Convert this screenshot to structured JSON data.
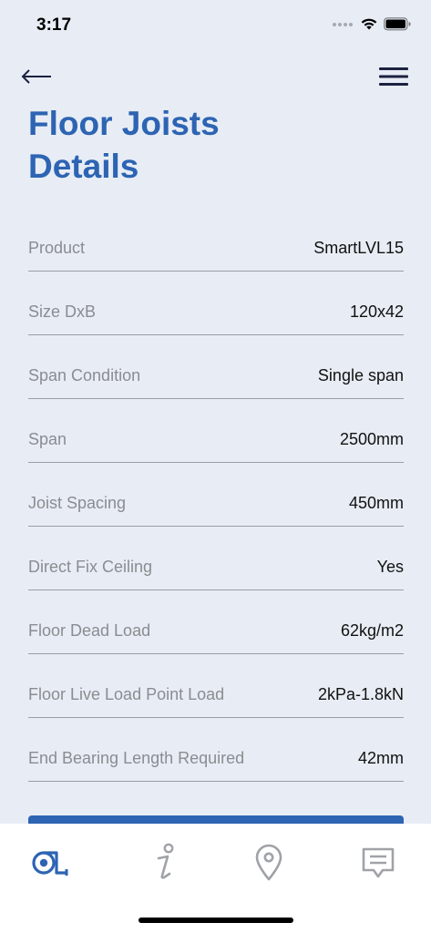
{
  "status": {
    "time": "3:17"
  },
  "page": {
    "title_line1": "Floor Joists",
    "title_line2": "Details"
  },
  "details": [
    {
      "label": "Product",
      "value": "SmartLVL15"
    },
    {
      "label": "Size DxB",
      "value": "120x42"
    },
    {
      "label": "Span Condition",
      "value": "Single span"
    },
    {
      "label": "Span",
      "value": "2500mm"
    },
    {
      "label": "Joist Spacing",
      "value": "450mm"
    },
    {
      "label": "Direct Fix Ceiling",
      "value": "Yes"
    },
    {
      "label": "Floor Dead Load",
      "value": "62kg/m2"
    },
    {
      "label": "Floor Live Load Point Load",
      "value": "2kPa-1.8kN"
    },
    {
      "label": "End Bearing Length Required",
      "value": "42mm"
    }
  ],
  "tabs": [
    {
      "icon": "tape-measure-icon",
      "active": true
    },
    {
      "icon": "info-icon",
      "active": false
    },
    {
      "icon": "location-pin-icon",
      "active": false
    },
    {
      "icon": "message-icon",
      "active": false
    }
  ],
  "colors": {
    "accent": "#2D64B3",
    "background": "#E8EDF5",
    "inactive_icon": "#A0A2A8",
    "label": "#8A8C90"
  }
}
